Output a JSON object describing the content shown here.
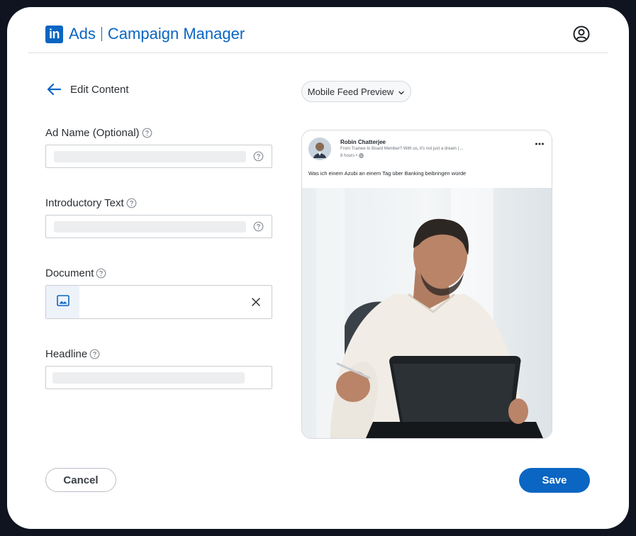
{
  "brand": {
    "logo_text": "in",
    "product": "Ads",
    "app_name": "Campaign Manager",
    "accent_color": "#0a66c2"
  },
  "header": {
    "profile_icon": "account-circle-icon"
  },
  "page": {
    "title": "Edit Content",
    "back_icon": "arrow-left-icon"
  },
  "form": {
    "ad_name": {
      "label": "Ad Name (Optional)",
      "value": ""
    },
    "introductory_text": {
      "label": "Introductory Text",
      "value": ""
    },
    "document": {
      "label": "Document",
      "thumb_icon": "image-icon",
      "remove_icon": "close-icon"
    },
    "headline": {
      "label": "Headline",
      "value": ""
    }
  },
  "actions": {
    "cancel_label": "Cancel",
    "save_label": "Save"
  },
  "preview": {
    "selector_label": "Mobile Feed Preview",
    "selector_icon": "chevron-down-icon",
    "post": {
      "author": "Robin Chatterjee",
      "subtitle": "From Trainee to Board Member? With us, it's not just a dream | ...",
      "time": "8 hours •",
      "text": "Was ich einem Azubi an einem Tag über Banking beibringen würde"
    }
  }
}
